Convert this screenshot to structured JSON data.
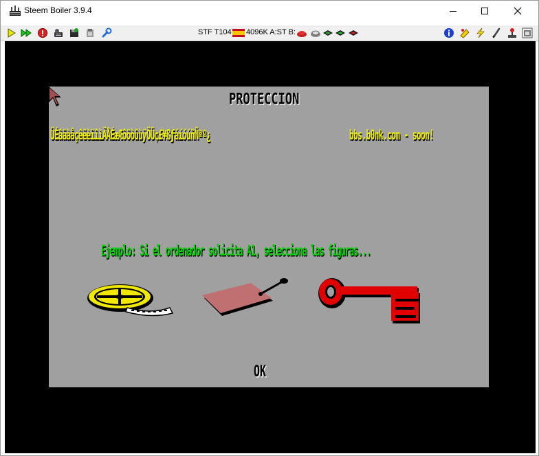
{
  "window": {
    "title": "Steem Boiler 3.9.4",
    "controls": [
      "minimize",
      "maximize",
      "close"
    ]
  },
  "toolbar": {
    "left_icons": [
      "play-icon",
      "fast-forward-icon",
      "stop-icon",
      "joystick-icon",
      "disk-manager-icon",
      "paste-icon",
      "options-wrench-icon"
    ],
    "status": {
      "machine": "STF T104",
      "memory_drives": "4096K A:ST B:",
      "flag_icon": "spain-flag-icon"
    },
    "right_icons": [
      "info-icon",
      "patches-icon",
      "shortcuts-lightning-icon",
      "options-pencil-icon",
      "joystick-settings-icon",
      "snapshot-icon"
    ]
  },
  "emulator_screen": {
    "background": "#000000",
    "panel_color": "#a0a0a0",
    "heading": "PROTECCION",
    "char_row": "ÜÉâäàåçêëèïîìÄÅÉæÆôöòûùÿÖÜ¢£¥ßƒáíóúñÑªº¿",
    "url_text": "bbs.b0nk.com - soon!",
    "instruction": "Ejemplo: Si el ordenador solicita A1, selecciona las figuras...",
    "ok_label": "OK",
    "figures": [
      "film-reel-icon",
      "luggage-tag-icon",
      "red-key-icon"
    ],
    "colors": {
      "yellow_text": "#f0f000",
      "green_text": "#00d000",
      "heading_text": "#000000",
      "key_red": "#e00000",
      "tag_pink": "#c07070"
    }
  }
}
